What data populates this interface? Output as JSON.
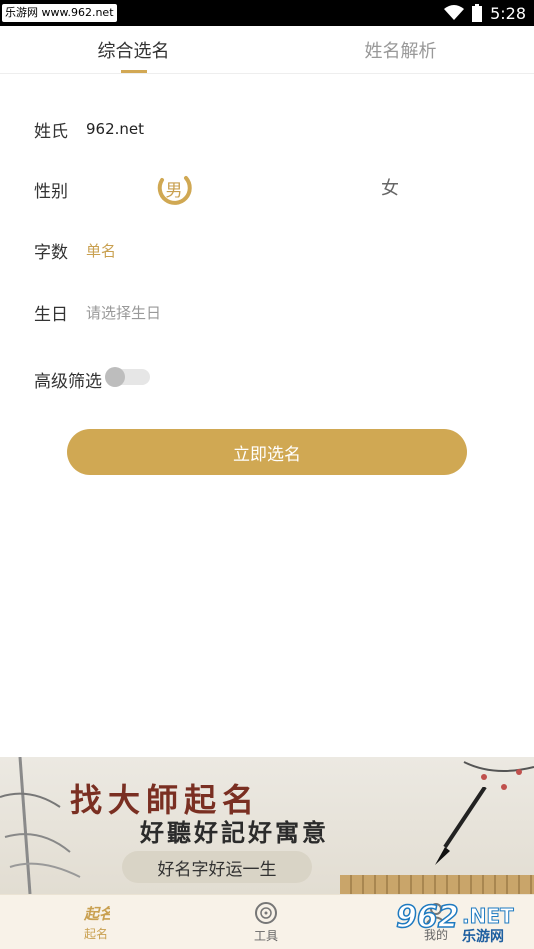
{
  "status_bar": {
    "site_label": "乐游网 www.962.net",
    "time": "5:28"
  },
  "tabs": [
    {
      "label": "综合选名",
      "active": true
    },
    {
      "label": "姓名解析",
      "active": false
    }
  ],
  "form": {
    "surname": {
      "label": "姓氏",
      "value": "962.net"
    },
    "gender": {
      "label": "性别",
      "male": "男",
      "female": "女",
      "selected": "男"
    },
    "count": {
      "label": "字数",
      "value": "单名"
    },
    "birthday": {
      "label": "生日",
      "placeholder": "请选择生日"
    },
    "advanced": {
      "label": "高级筛选",
      "enabled": false
    },
    "submit_label": "立即选名"
  },
  "banner": {
    "title": "找大師起名",
    "subtitle": "好聽好記好寓意",
    "pill": "好名字好运一生"
  },
  "bottom_nav": [
    {
      "label": "起名",
      "icon": "naming-calligraphy-icon",
      "active": true
    },
    {
      "label": "工具",
      "icon": "compass-icon",
      "active": false
    },
    {
      "label": "我的",
      "icon": "user-icon",
      "active": false
    }
  ],
  "watermark": {
    "big": "962",
    "suffix": ".NET",
    "sub": "乐游网"
  },
  "colors": {
    "accent": "#d0a853",
    "banner_title": "#7a2f22"
  }
}
